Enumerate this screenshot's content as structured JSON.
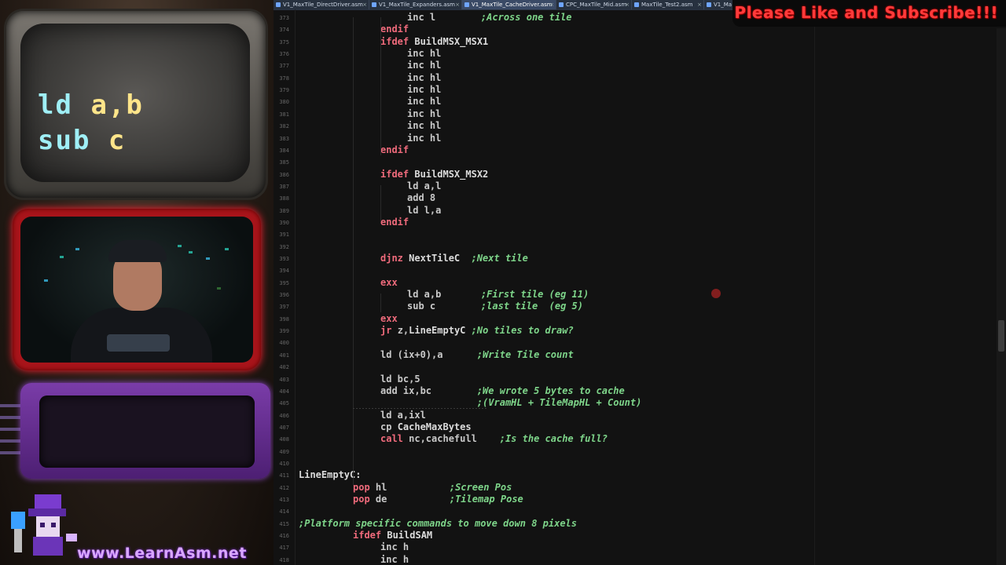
{
  "overlay": {
    "code_line1_op": "ld",
    "code_line1_args": "a,b",
    "code_line2_op": "sub",
    "code_line2_args": "c",
    "site": "www.LearnAsm.net",
    "banner": "Please Like and Subscribe!!!"
  },
  "tabs": [
    {
      "label": "V1_MaxTile_DirectDriver.asm",
      "active": false
    },
    {
      "label": "V1_MaxTile_Expanders.asm",
      "active": false
    },
    {
      "label": "V1_MaxTile_CacheDriver.asm",
      "active": true
    },
    {
      "label": "CPC_MaxTile_Mid.asm",
      "active": false
    },
    {
      "label": "MaxTile_Test2.asm",
      "active": false
    },
    {
      "label": "V1_Ma",
      "active": false
    }
  ],
  "code": [
    {
      "n": "373",
      "parts": [
        [
          "ins",
          "inc l"
        ],
        [
          "sp",
          "        "
        ],
        [
          "cm",
          ";Across one tile"
        ]
      ],
      "indent": 3
    },
    {
      "n": "374",
      "parts": [
        [
          "kw",
          "endif"
        ]
      ],
      "indent": 2
    },
    {
      "n": "375",
      "parts": [
        [
          "kw",
          "ifdef "
        ],
        [
          "lbl",
          "BuildMSX_MSX1"
        ]
      ],
      "indent": 2
    },
    {
      "n": "376",
      "parts": [
        [
          "ins",
          "inc hl"
        ]
      ],
      "indent": 3
    },
    {
      "n": "377",
      "parts": [
        [
          "ins",
          "inc hl"
        ]
      ],
      "indent": 3
    },
    {
      "n": "378",
      "parts": [
        [
          "ins",
          "inc hl"
        ]
      ],
      "indent": 3
    },
    {
      "n": "379",
      "parts": [
        [
          "ins",
          "inc hl"
        ]
      ],
      "indent": 3
    },
    {
      "n": "380",
      "parts": [
        [
          "ins",
          "inc hl"
        ]
      ],
      "indent": 3
    },
    {
      "n": "381",
      "parts": [
        [
          "ins",
          "inc hl"
        ]
      ],
      "indent": 3
    },
    {
      "n": "382",
      "parts": [
        [
          "ins",
          "inc hl"
        ]
      ],
      "indent": 3
    },
    {
      "n": "383",
      "parts": [
        [
          "ins",
          "inc hl"
        ]
      ],
      "indent": 3
    },
    {
      "n": "384",
      "parts": [
        [
          "kw",
          "endif"
        ]
      ],
      "indent": 2
    },
    {
      "n": "385",
      "parts": [],
      "indent": 2
    },
    {
      "n": "386",
      "parts": [
        [
          "kw",
          "ifdef "
        ],
        [
          "lbl",
          "BuildMSX_MSX2"
        ]
      ],
      "indent": 2
    },
    {
      "n": "387",
      "parts": [
        [
          "ins",
          "ld a,l"
        ]
      ],
      "indent": 3
    },
    {
      "n": "388",
      "parts": [
        [
          "ins",
          "add 8"
        ]
      ],
      "indent": 3
    },
    {
      "n": "389",
      "parts": [
        [
          "ins",
          "ld l,a"
        ]
      ],
      "indent": 3
    },
    {
      "n": "390",
      "parts": [
        [
          "kw",
          "endif"
        ]
      ],
      "indent": 2
    },
    {
      "n": "391",
      "parts": [],
      "indent": 2
    },
    {
      "n": "392",
      "parts": [],
      "indent": 2
    },
    {
      "n": "393",
      "parts": [
        [
          "kw",
          "djnz "
        ],
        [
          "lbl",
          "NextTileC"
        ],
        [
          "sp",
          "  "
        ],
        [
          "cm",
          ";Next tile"
        ]
      ],
      "indent": 2
    },
    {
      "n": "394",
      "parts": [],
      "indent": 2
    },
    {
      "n": "395",
      "parts": [
        [
          "kw",
          "exx"
        ]
      ],
      "indent": 2
    },
    {
      "n": "396",
      "parts": [
        [
          "ins",
          "ld a,b"
        ],
        [
          "sp",
          "       "
        ],
        [
          "cm",
          ";First tile (eg 11)"
        ]
      ],
      "indent": 3
    },
    {
      "n": "397",
      "parts": [
        [
          "ins",
          "sub c"
        ],
        [
          "sp",
          "        "
        ],
        [
          "cm",
          ";last tile  (eg 5)"
        ]
      ],
      "indent": 3
    },
    {
      "n": "398",
      "parts": [
        [
          "kw",
          "exx"
        ]
      ],
      "indent": 2
    },
    {
      "n": "399",
      "parts": [
        [
          "kw",
          "jr "
        ],
        [
          "ins",
          "z,"
        ],
        [
          "lbl",
          "LineEmptyC"
        ],
        [
          "sp",
          " "
        ],
        [
          "cm",
          ";No tiles to draw?"
        ]
      ],
      "indent": 2
    },
    {
      "n": "400",
      "parts": [],
      "indent": 2
    },
    {
      "n": "401",
      "parts": [
        [
          "ins",
          "ld (ix+0),a"
        ],
        [
          "sp",
          "      "
        ],
        [
          "cm",
          ";Write Tile count"
        ]
      ],
      "indent": 2
    },
    {
      "n": "402",
      "parts": [],
      "indent": 2
    },
    {
      "n": "403",
      "parts": [
        [
          "ins",
          "ld bc,5"
        ]
      ],
      "indent": 2
    },
    {
      "n": "404",
      "parts": [
        [
          "ins",
          "add ix,bc"
        ],
        [
          "sp",
          "        "
        ],
        [
          "cm",
          ";We wrote 5 bytes to cache"
        ]
      ],
      "indent": 2
    },
    {
      "n": "405",
      "parts": [
        [
          "sp",
          "                 "
        ],
        [
          "cm",
          ";(VramHL + TileMapHL + Count)"
        ]
      ],
      "indent": 2
    },
    {
      "n": "406",
      "parts": [
        [
          "ins",
          "ld a,ixl"
        ]
      ],
      "indent": 2
    },
    {
      "n": "407",
      "parts": [
        [
          "ins",
          "cp "
        ],
        [
          "lbl",
          "CacheMaxBytes"
        ]
      ],
      "indent": 2
    },
    {
      "n": "408",
      "parts": [
        [
          "kw",
          "call "
        ],
        [
          "ins",
          "nc,cachefull"
        ],
        [
          "sp",
          "    "
        ],
        [
          "cm",
          ";Is the cache full?"
        ]
      ],
      "indent": 2
    },
    {
      "n": "409",
      "parts": [],
      "indent": 2
    },
    {
      "n": "410",
      "parts": [],
      "indent": 2
    },
    {
      "n": "411",
      "parts": [
        [
          "lbl",
          "LineEmptyC:"
        ]
      ],
      "indent": 0
    },
    {
      "n": "412",
      "parts": [
        [
          "kw",
          "pop "
        ],
        [
          "ins",
          "hl"
        ],
        [
          "sp",
          "           "
        ],
        [
          "cm",
          ";Screen Pos"
        ]
      ],
      "indent": 1
    },
    {
      "n": "413",
      "parts": [
        [
          "kw",
          "pop "
        ],
        [
          "ins",
          "de"
        ],
        [
          "sp",
          "           "
        ],
        [
          "cm",
          ";Tilemap Pose"
        ]
      ],
      "indent": 1
    },
    {
      "n": "414",
      "parts": [],
      "indent": 0
    },
    {
      "n": "415",
      "parts": [
        [
          "cm",
          ";Platform specific commands to move down 8 pixels"
        ]
      ],
      "indent": 0
    },
    {
      "n": "416",
      "parts": [
        [
          "kw",
          "ifdef "
        ],
        [
          "lbl",
          "BuildSAM"
        ]
      ],
      "indent": 1
    },
    {
      "n": "417",
      "parts": [
        [
          "ins",
          "inc h"
        ]
      ],
      "indent": 2
    },
    {
      "n": "418",
      "parts": [
        [
          "ins",
          "inc h"
        ]
      ],
      "indent": 2
    }
  ],
  "colors": {
    "keyword": "#f06b7c",
    "comment": "#7ed58a",
    "banner": "#ff3b3b",
    "camera_frame": "#a8141a"
  }
}
